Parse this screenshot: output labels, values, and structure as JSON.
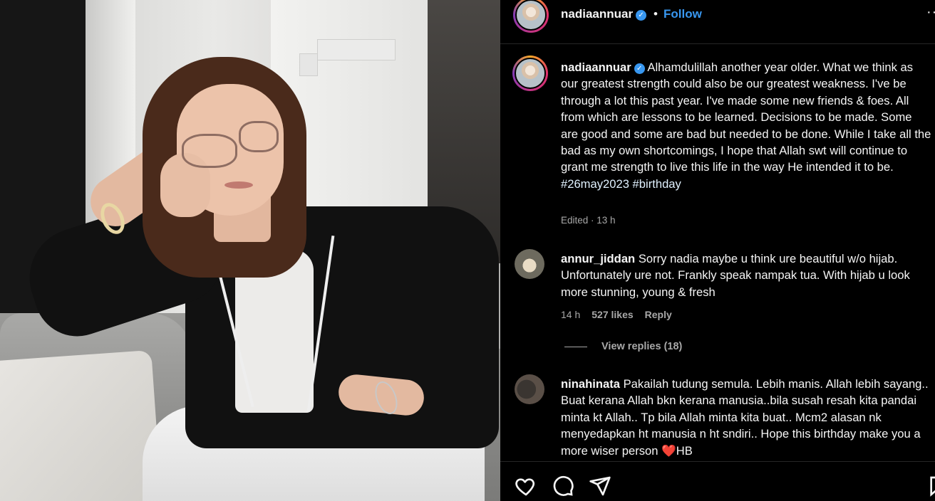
{
  "post": {
    "username": "nadiaannuar",
    "follow_label": "Follow",
    "separator": "•",
    "more_label": "···",
    "caption": {
      "username": "nadiaannuar",
      "text": "Alhamdulillah another year older. What we think as our greatest strength could also be our greatest weakness. I've be through a lot this past year. I've made some new friends & foes. All from which are lessons to be learned. Decisions to be made. Some are good and some are bad but needed to be done. While I take all the bad as my own shortcomings, I hope that Allah swt will continue to grant me strength to live this life in the way He intended it to be.",
      "hashtags": "#26may2023 #birthday",
      "edited": "Edited · 13 h"
    }
  },
  "comments": [
    {
      "username": "annur_jiddan",
      "text": "Sorry nadia maybe u think ure beautiful w/o hijab. Unfortunately ure not. Frankly speak nampak tua. With hijab u look more stunning, young & fresh",
      "time": "14 h",
      "likes": "527 likes",
      "reply_label": "Reply",
      "view_replies": "View replies (18)"
    },
    {
      "username": "ninahinata",
      "text": "Pakailah tudung semula. Lebih manis. Allah lebih sayang.. Buat kerana Allah bkn kerana manusia..bila susah resah kita pandai minta kt Allah.. Tp bila Allah minta kita buat.. Mcm2 alasan nk menyedapkan ht manusia n ht sndiri.. Hope this birthday make you a more wiser person",
      "emoji": "❤️",
      "suffix": "HB"
    }
  ],
  "icons": {
    "verified": "verified-badge-icon",
    "like": "heart-icon",
    "comment": "comment-bubble-icon",
    "share": "paper-plane-icon",
    "save": "bookmark-icon"
  },
  "colors": {
    "background": "#000000",
    "text": "#f5f5f5",
    "muted": "#a8a8a8",
    "link": "#3897f0",
    "divider": "#262626"
  }
}
